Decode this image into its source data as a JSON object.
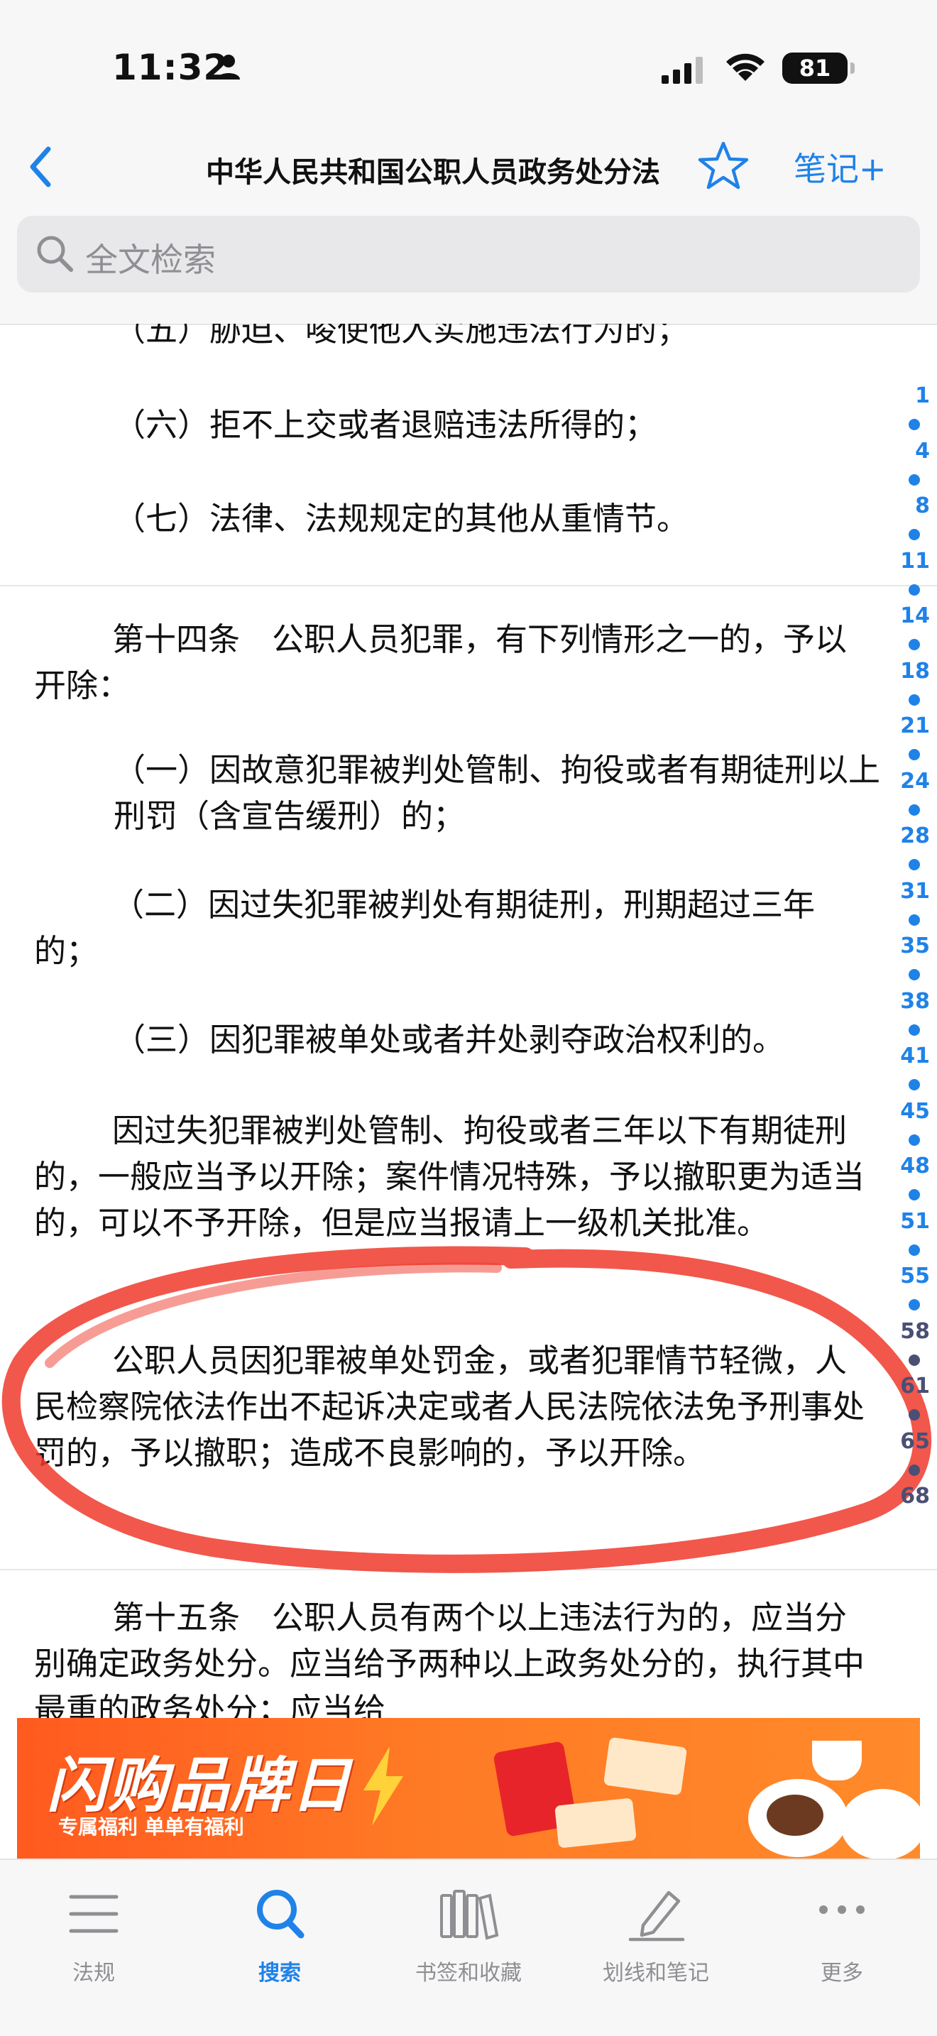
{
  "status_bar": {
    "time": "11:32",
    "battery": "81"
  },
  "nav": {
    "title": "中华人民共和国公职人员政务处分法",
    "notes_label": "笔记+"
  },
  "search": {
    "placeholder": "全文检索"
  },
  "content": {
    "item_5": "（五）胁迫、唆使他人实施违法行为的；",
    "item_6": "（六）拒不上交或者退赔违法所得的；",
    "item_7": "（七）法律、法规规定的其他从重情节。",
    "article_14_intro": "第十四条　公职人员犯罪，有下列情形之一的，予以开除：",
    "article_14_item_1": "（一）因故意犯罪被判处管制、拘役或者有期徒刑以上刑罚（含宣告缓刑）的；",
    "article_14_item_2": "（二）因过失犯罪被判处有期徒刑，刑期超过三年的；",
    "article_14_item_3": "（三）因犯罪被单处或者并处剥夺政治权利的。",
    "article_14_para_2": "因过失犯罪被判处管制、拘役或者三年以下有期徒刑的，一般应当予以开除；案件情况特殊，予以撤职更为适当的，可以不予开除，但是应当报请上一级机关批准。",
    "article_14_para_3": "公职人员因犯罪被单处罚金，或者犯罪情节轻微，人民检察院依法作出不起诉决定或者人民法院依法免予刑事处罚的，予以撤职；造成不良影响的，予以开除。",
    "article_15_intro": "第十五条　公职人员有两个以上违法行为的，应当分别确定政务处分。应当给予两种以上政务处分的，执行其中最重的政务处分；应当给"
  },
  "index_rail": [
    "1",
    "4",
    "8",
    "11",
    "14",
    "18",
    "21",
    "24",
    "28",
    "31",
    "35",
    "38",
    "41",
    "45",
    "48",
    "51",
    "55",
    "58",
    "61",
    "65",
    "68"
  ],
  "ad": {
    "title": "闪购品牌日",
    "subtitle": "专属福利 单单有福利"
  },
  "tabs": [
    {
      "label": "法规",
      "icon": "menu-icon"
    },
    {
      "label": "搜索",
      "icon": "search-icon"
    },
    {
      "label": "书签和收藏",
      "icon": "books-icon"
    },
    {
      "label": "划线和笔记",
      "icon": "pencil-icon"
    },
    {
      "label": "更多",
      "icon": "more-icon"
    }
  ],
  "colors": {
    "accent": "#1f82e8",
    "annotation": "#f0392b"
  }
}
